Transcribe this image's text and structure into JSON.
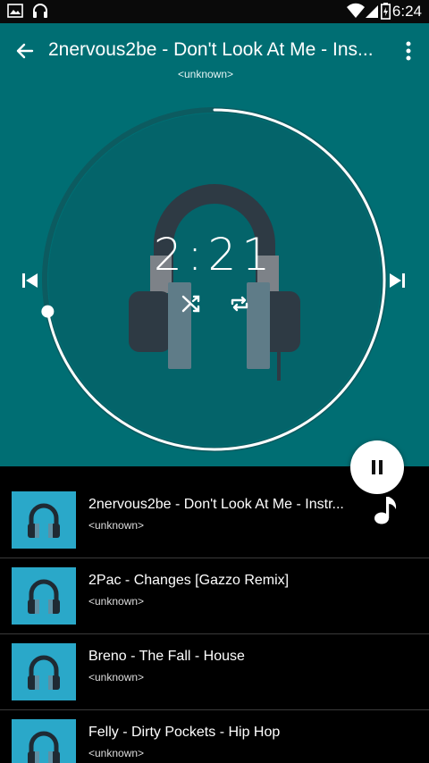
{
  "status_bar": {
    "time": "6:24"
  },
  "player": {
    "title": "2nervous2be - Don't Look At Me - Ins...",
    "artist": "<unknown>",
    "time": "2:21",
    "progress": 0.72,
    "colors": {
      "background": "#006e73",
      "accent": "#ffffff",
      "thumbnail": "#2aa8c9"
    }
  },
  "playlist": {
    "items": [
      {
        "title": "2nervous2be - Don't Look At Me - Instr...",
        "artist": "<unknown>"
      },
      {
        "title": "2Pac - Changes [Gazzo Remix]",
        "artist": "<unknown>"
      },
      {
        "title": "Breno - The Fall - House",
        "artist": "<unknown>"
      },
      {
        "title": "Felly - Dirty Pockets - Hip Hop",
        "artist": "<unknown>"
      }
    ]
  },
  "icons": [
    "image-icon",
    "headphones-icon",
    "wifi-icon",
    "signal-icon",
    "battery-icon",
    "back-arrow-icon",
    "more-vert-icon",
    "skip-previous-icon",
    "skip-next-icon",
    "shuffle-icon",
    "repeat-icon",
    "pause-icon",
    "music-note-icon"
  ]
}
